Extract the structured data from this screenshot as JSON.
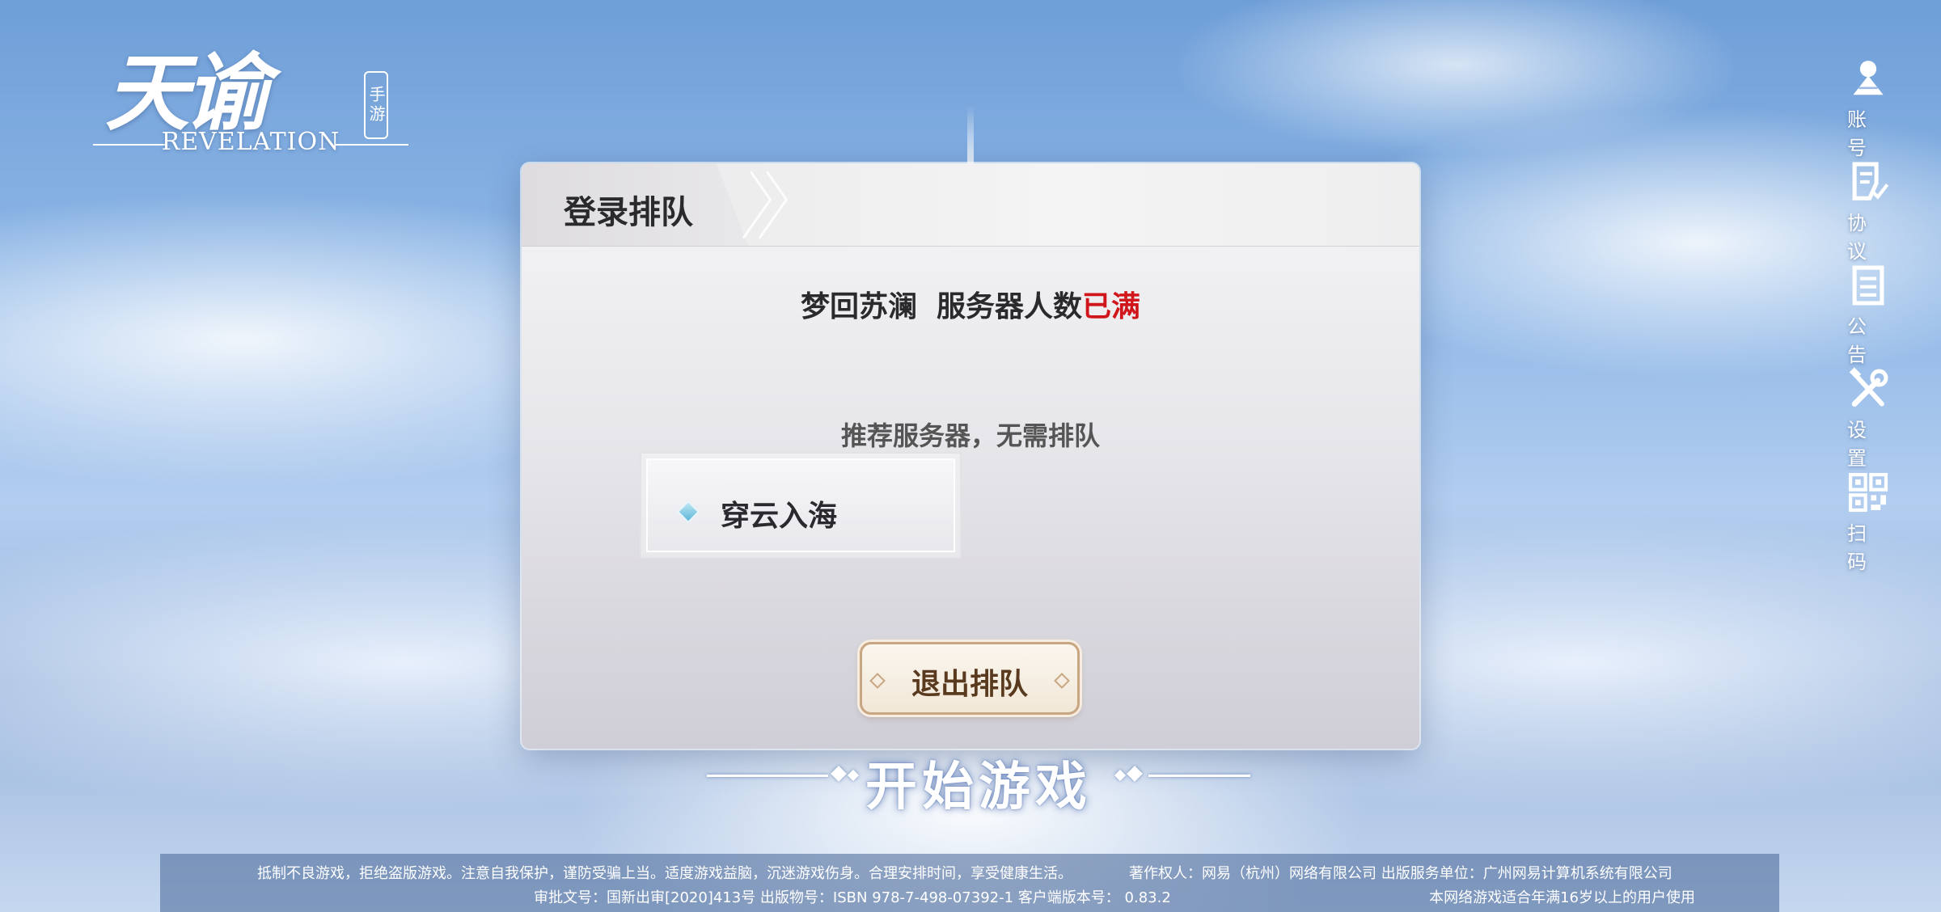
{
  "logo": {
    "title_cn": "天谕",
    "tag": "手游",
    "title_en": "REVELATION"
  },
  "side_menu": [
    {
      "label": "账号",
      "icon": "account-icon"
    },
    {
      "label": "协议",
      "icon": "agreement-icon"
    },
    {
      "label": "公告",
      "icon": "announcement-icon"
    },
    {
      "label": "设置",
      "icon": "settings-icon"
    },
    {
      "label": "扫码",
      "icon": "qr-code-icon"
    }
  ],
  "dialog": {
    "title": "登录排队",
    "server_name": "梦回苏澜",
    "status_prefix": "服务器人数",
    "status_full": "已满",
    "recommend_text": "推荐服务器，无需排队",
    "recommended_server": "穿云入海",
    "exit_button": "退出排队"
  },
  "start_game": "开始游戏",
  "footer": {
    "health_notice": "抵制不良游戏，拒绝盗版游戏。注意自我保护，谨防受骗上当。适度游戏益脑，沉迷游戏伤身。合理安排时间，享受健康生活。",
    "copyright": "著作权人：网易（杭州）网络有限公司 出版服务单位：广州网易计算机系统有限公司",
    "approval": "审批文号：国新出审[2020]413号 出版物号：ISBN 978-7-498-07392-1  客户端版本号：",
    "version": "0.83.2",
    "age_notice": "本网络游戏适合年满16岁以上的用户使用"
  },
  "colors": {
    "status_full": "#d0161b",
    "button_border": "#c8a682",
    "sky": "#8db6e6"
  }
}
